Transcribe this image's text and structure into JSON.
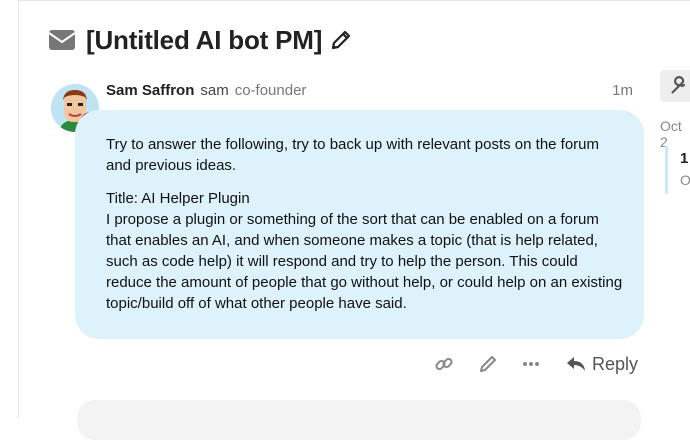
{
  "topic": {
    "title": "[Untitled AI bot PM]"
  },
  "post": {
    "username": "Sam Saffron",
    "handle": "sam",
    "user_title": "co-founder",
    "age": "1m",
    "paragraphs": [
      "Try to answer the following, try to back up with relevant posts on the forum and previous ideas.",
      "Title: AI Helper Plugin",
      "I propose a plugin or something of the sort that can be enabled on a forum that enables an AI, and when someone makes a topic (that is help related, such as code help) it will respond and try to help the person. This could reduce the amount of people that go without help, or could help on an existing topic/build off of what other people have said."
    ]
  },
  "actions": {
    "reply_label": "Reply"
  },
  "sidebar": {
    "date_label": "Oct 2",
    "progress_number": "1",
    "progress_sub": "O"
  },
  "colors": {
    "bubble": "#def2fc",
    "text": "#222222",
    "muted": "#777777"
  },
  "icons": [
    "envelope-icon",
    "pencil-icon",
    "link-icon",
    "edit-icon",
    "more-icon",
    "reply-icon",
    "wrench-icon"
  ]
}
